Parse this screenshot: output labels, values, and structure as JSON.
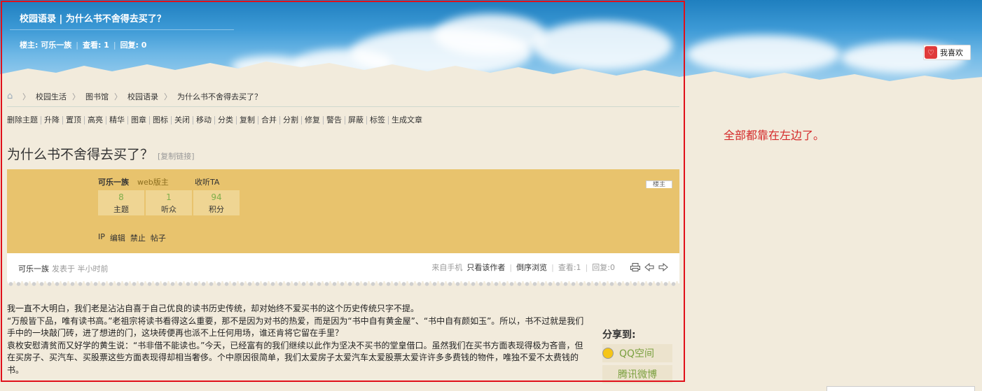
{
  "header": {
    "title": "校园语录 | 为什么书不舍得去买了？",
    "owner": "楼主: 可乐一族",
    "views": "查看: 1",
    "replies": "回复: 0",
    "like_label": "我喜欢"
  },
  "breadcrumb": [
    "校园生活",
    "图书馆",
    "校园语录",
    "为什么书不舍得去买了？"
  ],
  "mod_actions": [
    "删除主题",
    "升降",
    "置顶",
    "高亮",
    "精华",
    "图章",
    "图标",
    "关闭",
    "移动",
    "分类",
    "复制",
    "合并",
    "分割",
    "修复",
    "警告",
    "屏蔽",
    "标签",
    "生成文章"
  ],
  "post": {
    "title": "为什么书不舍得去买了？",
    "copy_link": "[复制链接]"
  },
  "author": {
    "name": "可乐一族",
    "role": "web版主",
    "follow": "收听TA",
    "corner_label": "楼主",
    "stats": [
      {
        "num": "8",
        "label": "主题"
      },
      {
        "num": "1",
        "label": "听众"
      },
      {
        "num": "94",
        "label": "积分"
      }
    ],
    "admin_links": [
      "IP",
      "编辑",
      "禁止",
      "帖子"
    ]
  },
  "post_bar": {
    "author": "可乐一族",
    "posted": "发表于 半小时前",
    "from_mobile": "来自手机",
    "only_author": "只看该作者",
    "reverse": "倒序浏览",
    "views": "查看:1",
    "replies": "回复:0"
  },
  "content": [
    "我一直不大明白，我们老是沾沾自喜于自己优良的读书历史传统，却对始终不爱买书的这个历史传统只字不提。",
    "“万般皆下品，唯有读书高。”老祖宗将读书看得这么重要，那不是因为对书的热爱，而是因为“书中自有黄金屋”、“书中自有颜如玉”。所以，书不过就是我们手中的一块敲门砖，进了想进的门，这块砖便再也派不上任何用场，谁还肯将它留在手里？",
    "袁枚安慰清贫而又好学的黄生说：“书非借不能读也。”今天，已经富有的我们继续以此作为坚决不买书的堂皇借口。虽然我们在买书方面表现得极为吝啬，但在买房子、买汽车、买股票这些方面表现得却相当奢侈。个中原因很简单，我们太爱房子太爱汽车太爱股票太爱许许多多费钱的物件，唯独不爱不太费钱的书。"
  ],
  "share": {
    "title": "分享到:",
    "qq": "QQ空间",
    "weibo": "腾讯微博"
  },
  "annotation": "全部都靠在左边了。"
}
